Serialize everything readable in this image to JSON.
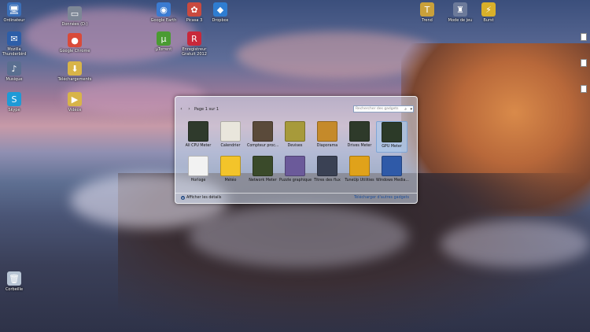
{
  "desktop_icons": [
    {
      "label": "Ordinateur",
      "glyph": "🖥",
      "color": "#3a6fb8"
    },
    {
      "label": "Mozilla\nThunderbird",
      "glyph": "✉",
      "color": "#2d5ea8"
    },
    {
      "label": "Musique",
      "glyph": "♪",
      "color": "#5a6f90"
    },
    {
      "label": "Skype",
      "glyph": "S",
      "color": "#1f9ad6"
    },
    {
      "label": "Données (D:)",
      "glyph": "▭",
      "color": "#7d8796"
    },
    {
      "label": "Google Chrome",
      "glyph": "●",
      "color": "#d94a3a"
    },
    {
      "label": "Téléchargements",
      "glyph": "⬇",
      "color": "#d8b448"
    },
    {
      "label": "Vidéos",
      "glyph": "▶",
      "color": "#d8b448"
    },
    {
      "label": "Google Earth",
      "glyph": "◉",
      "color": "#3b7bd1"
    },
    {
      "label": "µTorrent",
      "glyph": "µ",
      "color": "#4a9b32"
    },
    {
      "label": "Picasa 3",
      "glyph": "✿",
      "color": "#c94a3f"
    },
    {
      "label": "Enregistreur\nGratuit 2012",
      "glyph": "R",
      "color": "#c8283a"
    },
    {
      "label": "Dropbox",
      "glyph": "◆",
      "color": "#2f7dd1"
    },
    {
      "label": "Trend",
      "glyph": "T",
      "color": "#c9a03a"
    },
    {
      "label": "Mode de jeu",
      "glyph": "♜",
      "color": "#6c7a9a"
    },
    {
      "label": "Burst",
      "glyph": "⚡",
      "color": "#d9b02a"
    },
    {
      "label": "Corbeille",
      "glyph": "🗑",
      "color": "#b7c4d4"
    }
  ],
  "gallery": {
    "page_label": "Page 1 sur 1",
    "search_placeholder": "Rechercher des gadgets",
    "details_label": "Afficher les détails",
    "download_label": "Télécharger d'autres gadgets",
    "gadgets": [
      {
        "name": "All CPU Meter",
        "color": "#2f3a2c",
        "selected": false
      },
      {
        "name": "Calendrier",
        "color": "#e9e6dc",
        "selected": false
      },
      {
        "name": "Compteur proc...",
        "color": "#5a4a3a",
        "selected": false
      },
      {
        "name": "Devises",
        "color": "#a79a3a",
        "selected": false
      },
      {
        "name": "Diaporama",
        "color": "#c58a2a",
        "selected": false
      },
      {
        "name": "Drives Meter",
        "color": "#2e3a2a",
        "selected": false
      },
      {
        "name": "GPU Meter",
        "color": "#2c3a28",
        "selected": true
      },
      {
        "name": "Horloge",
        "color": "#f2f2f2",
        "selected": false
      },
      {
        "name": "Météo",
        "color": "#f3c42a",
        "selected": false
      },
      {
        "name": "Network Meter",
        "color": "#3a4a2a",
        "selected": false
      },
      {
        "name": "Puzzle graphique",
        "color": "#6b5a9a",
        "selected": false
      },
      {
        "name": "Titres des flux",
        "color": "#3a4154",
        "selected": false
      },
      {
        "name": "TuneUp Utilities",
        "color": "#e0a21a",
        "selected": false
      },
      {
        "name": "Windows Media...",
        "color": "#2f5aa8",
        "selected": false
      }
    ]
  }
}
